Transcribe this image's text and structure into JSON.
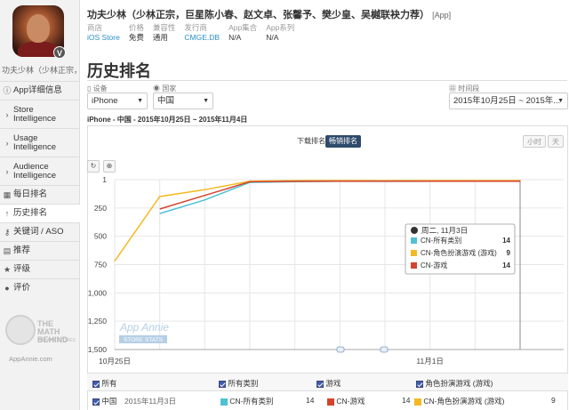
{
  "app": {
    "title": "功夫少林（少林正宗，巨星陈小春、赵文卓、张馨予、樊少皇、吴樾联袂力荐）",
    "platform_tag": "[App]",
    "sidebar_title": "功夫少林（少林正宗，...",
    "badge": "V"
  },
  "meta": [
    {
      "label": "商店",
      "value": "iOS Store",
      "link": true
    },
    {
      "label": "价格",
      "value": "免费",
      "link": false
    },
    {
      "label": "兼容性",
      "value": "通用",
      "link": false
    },
    {
      "label": "发行商",
      "value": "CMGE.DB",
      "link": true
    },
    {
      "label": "App集合",
      "value": "N/A",
      "link": false
    },
    {
      "label": "App系列",
      "value": "N/A",
      "link": false
    }
  ],
  "sidebar": {
    "items": [
      {
        "label": "App详细信息",
        "icon": "info-icon",
        "glyph": "ⓘ",
        "lines": 1
      },
      {
        "label": "Store\nIntelligence",
        "icon": "chevron-right-icon",
        "glyph": "›",
        "lines": 2
      },
      {
        "label": "Usage\nIntelligence",
        "icon": "chevron-right-icon",
        "glyph": "›",
        "lines": 2
      },
      {
        "label": "Audience\nIntelligence",
        "icon": "chevron-right-icon",
        "glyph": "›",
        "lines": 2
      },
      {
        "label": "每日排名",
        "icon": "calendar-icon",
        "glyph": "▦",
        "lines": 1
      },
      {
        "label": "历史排名",
        "icon": "arrow-up-icon",
        "glyph": "↑",
        "lines": 1,
        "active": true
      },
      {
        "label": "关键词 / ASO",
        "icon": "key-icon",
        "glyph": "⚷",
        "lines": 1
      },
      {
        "label": "推荐",
        "icon": "book-icon",
        "glyph": "▤",
        "lines": 1
      },
      {
        "label": "评级",
        "icon": "star-icon",
        "glyph": "★",
        "lines": 1
      },
      {
        "label": "评价",
        "icon": "comment-icon",
        "glyph": "●",
        "lines": 1
      }
    ],
    "logo": {
      "line1": "THE MATH",
      "line2": "BEHIND",
      "line3": "THE APP STORES",
      "url": "AppAnnie.com"
    }
  },
  "page_title": "历史排名",
  "filters": {
    "device_label": "设备",
    "device_value": "iPhone",
    "country_label": "国家",
    "country_value": "中国",
    "range_label": "时间段",
    "range_value": "2015年10月25日 ~ 2015年..."
  },
  "subtitle": "iPhone - 中国 - 2015年10月25日 ~ 2015年11月4日",
  "toggles": {
    "download": "下载排名",
    "grossing": "畅销排名",
    "hour": "小时",
    "day": "天"
  },
  "tooltip": {
    "date": "周二, 11月3日",
    "rows": [
      {
        "name": "CN-所有类别",
        "value": "14",
        "color": "#4fc1d6"
      },
      {
        "name": "CN-角色扮演游戏 (游戏)",
        "value": "9",
        "color": "#f4b922"
      },
      {
        "name": "CN-游戏",
        "value": "14",
        "color": "#d4432e"
      }
    ]
  },
  "watermark": {
    "line1": "App Annie",
    "line2": "STORE STATS"
  },
  "chart_data": {
    "type": "line",
    "x": [
      "10月25日",
      "10月26日",
      "10月27日",
      "10月28日",
      "10月29日",
      "10月30日",
      "10月31日",
      "11月1日",
      "11月2日",
      "11月3日"
    ],
    "x_tick_labels": [
      "10月25日",
      "11月1日"
    ],
    "y_inverted": true,
    "ylim": [
      1,
      1500
    ],
    "yticks": [
      "1",
      "250",
      "500",
      "750",
      "1,000",
      "1,250",
      "1,500"
    ],
    "series": [
      {
        "name": "CN-所有类别",
        "color": "#4fc1d6",
        "values": [
          null,
          300,
          180,
          25,
          18,
          15,
          16,
          15,
          14,
          14
        ]
      },
      {
        "name": "CN-角色扮演游戏 (游戏)",
        "color": "#f4b922",
        "values": [
          720,
          150,
          90,
          15,
          10,
          9,
          10,
          9,
          9,
          9
        ]
      },
      {
        "name": "CN-游戏",
        "color": "#d4432e",
        "values": [
          null,
          260,
          140,
          20,
          16,
          14,
          15,
          14,
          14,
          14
        ]
      }
    ]
  },
  "legend": {
    "header": {
      "all": "所有",
      "cat_all": "所有类别",
      "cat_games": "游戏",
      "cat_rpg": "角色扮演游戏 (游戏)"
    },
    "row": {
      "country": "中国",
      "date": "2015年11月3日",
      "all_name": "CN-所有类别",
      "all_value": "14",
      "games_name": "CN-游戏",
      "games_value": "14",
      "rpg_name": "CN-角色扮演游戏 (游戏)",
      "rpg_value": "9"
    }
  },
  "colors": {
    "cyan": "#4fc1d6",
    "yellow": "#f4b922",
    "red": "#d4432e",
    "dark_btn": "#2e4b6b"
  }
}
